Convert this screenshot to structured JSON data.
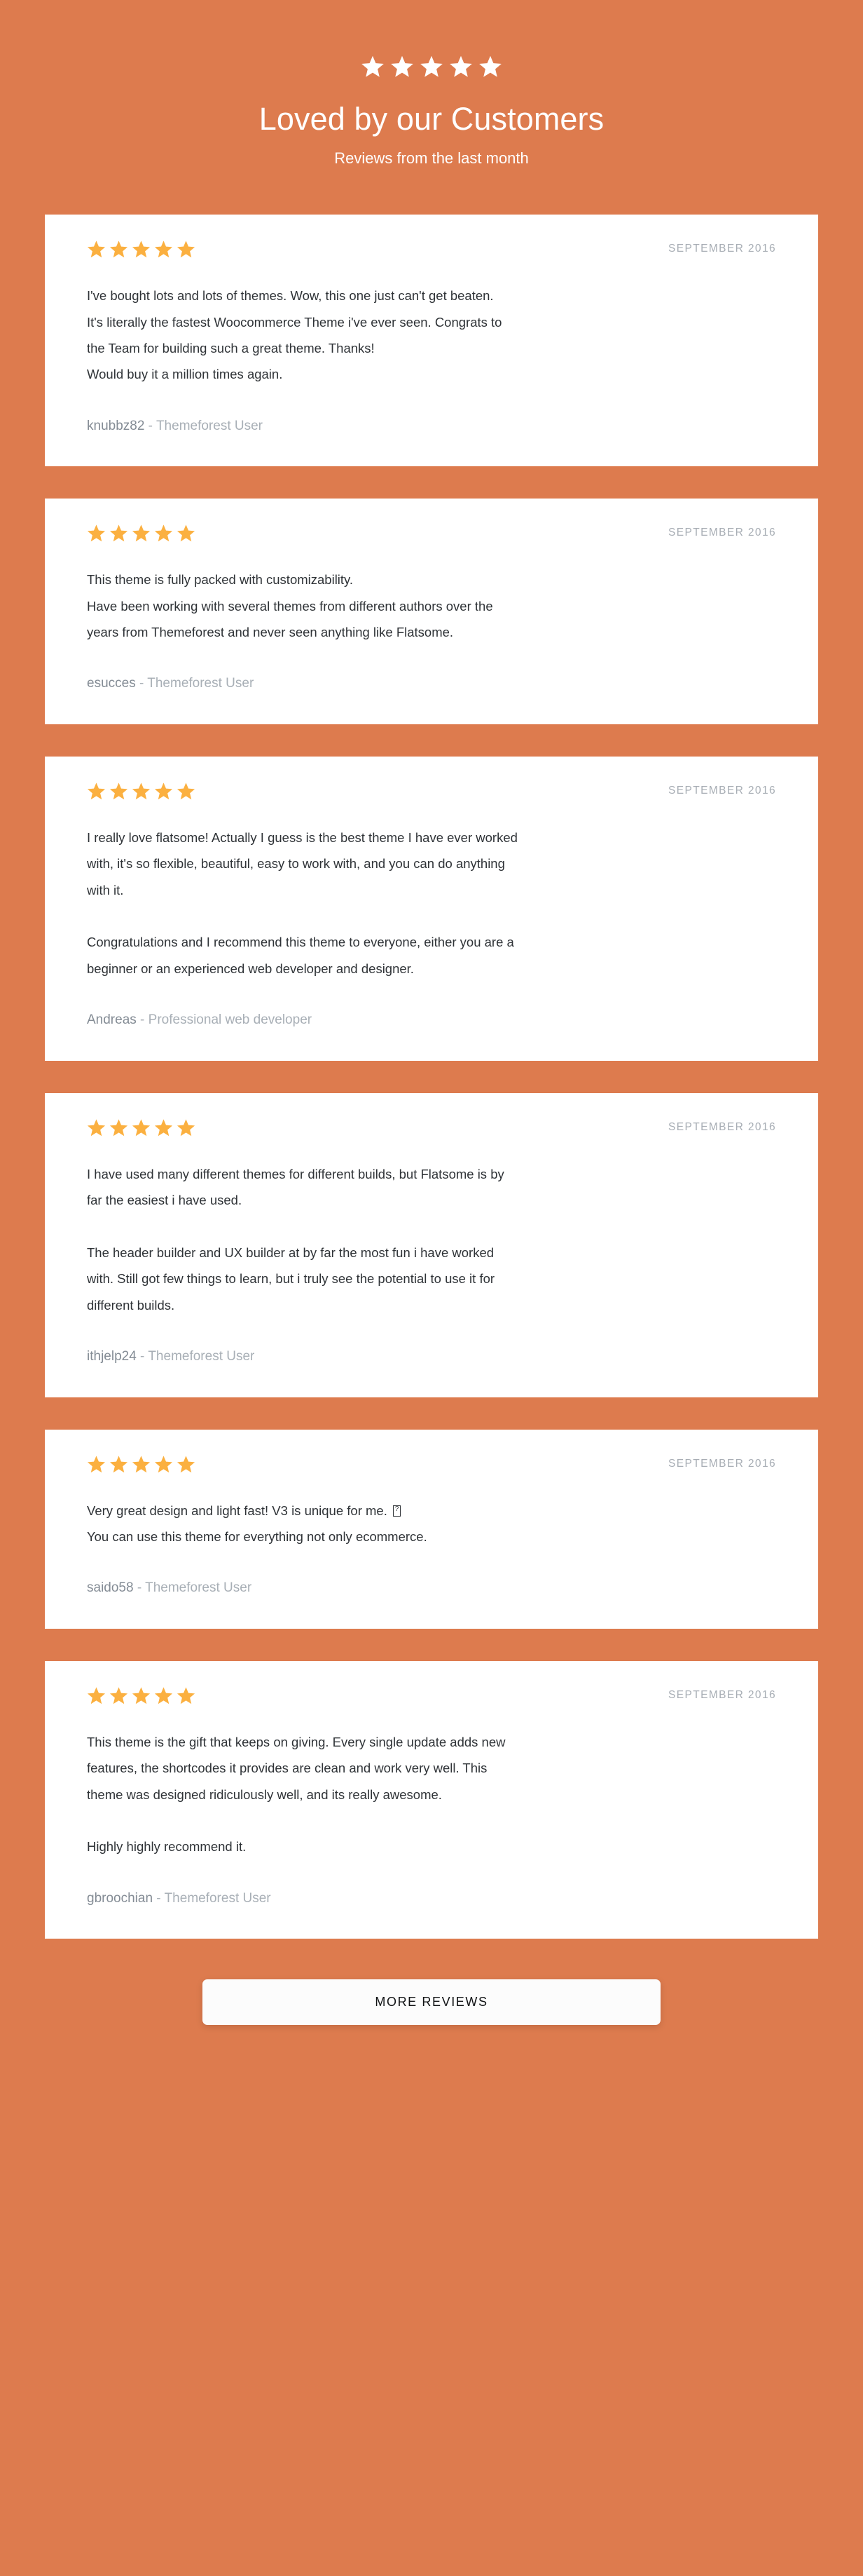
{
  "theme": {
    "background_color": "#dd7b4e",
    "card_color": "#ffffff",
    "star_color_header": "#ffffff",
    "star_color_card": "#fbb040",
    "body_text_color": "#2f3337",
    "muted_text_color": "#a7adb4",
    "button_color": "#fcfcfc"
  },
  "header": {
    "stars_icon": "star-icon",
    "stars_count": 5,
    "title": "Loved by our Customers",
    "subtitle": "Reviews from the last month"
  },
  "reviews": [
    {
      "stars_count": 5,
      "stars_icon": "star-icon",
      "date": "SEPTEMBER 2016",
      "body": "I've bought lots and lots of themes. Wow, this one just can't get beaten.\nIt's literally the fastest Woocommerce Theme i've ever seen. Congrats to\nthe Team for building such a great theme. Thanks!\nWould buy it a million times again.",
      "author_name": "knubbz82",
      "author_separator": " - ",
      "author_role": "Themeforest User"
    },
    {
      "stars_count": 5,
      "stars_icon": "star-icon",
      "date": "SEPTEMBER 2016",
      "body": "This theme is fully packed with customizability.\nHave been working with several themes from different authors over the\nyears from Themeforest and never seen anything like Flatsome.",
      "author_name": "esucces",
      "author_separator": " - ",
      "author_role": "Themeforest User"
    },
    {
      "stars_count": 5,
      "stars_icon": "star-icon",
      "date": "SEPTEMBER 2016",
      "body": "I really love flatsome! Actually I guess is the best theme I have ever worked\nwith, it's so flexible, beautiful, easy to work with, and you can do anything\nwith it.\n\nCongratulations and I recommend this theme to everyone, either you are a\nbeginner or an experienced web developer and designer.",
      "author_name": "Andreas",
      "author_separator": " - ",
      "author_role": "Professional web developer"
    },
    {
      "stars_count": 5,
      "stars_icon": "star-icon",
      "date": "SEPTEMBER 2016",
      "body": "I have used many different themes for different builds, but Flatsome is by\nfar the easiest i have used.\n\nThe header builder and UX builder at by far the most fun i have worked\nwith. Still got few things to learn, but i truly see the potential to use it for\ndifferent builds.",
      "author_name": "ithjelp24",
      "author_separator": " - ",
      "author_role": "Themeforest User"
    },
    {
      "stars_count": 5,
      "stars_icon": "star-icon",
      "date": "SEPTEMBER 2016",
      "body_part1": "Very great design and light fast! V3 is unique for me. ",
      "body_part2": "\nYou can use this theme for everything not only ecommerce.",
      "has_missing_glyph": true,
      "author_name": "saido58",
      "author_separator": " - ",
      "author_role": "Themeforest User"
    },
    {
      "stars_count": 5,
      "stars_icon": "star-icon",
      "date": "SEPTEMBER 2016",
      "body": "This theme is the gift that keeps on giving. Every single update adds new\nfeatures, the shortcodes it provides are clean and work very well. This\ntheme was designed ridiculously well, and its really awesome.\n\nHighly highly recommend it.",
      "author_name": "gbroochian",
      "author_separator": " - ",
      "author_role": "Themeforest User"
    }
  ],
  "footer": {
    "more_reviews_label": "MORE REVIEWS"
  }
}
